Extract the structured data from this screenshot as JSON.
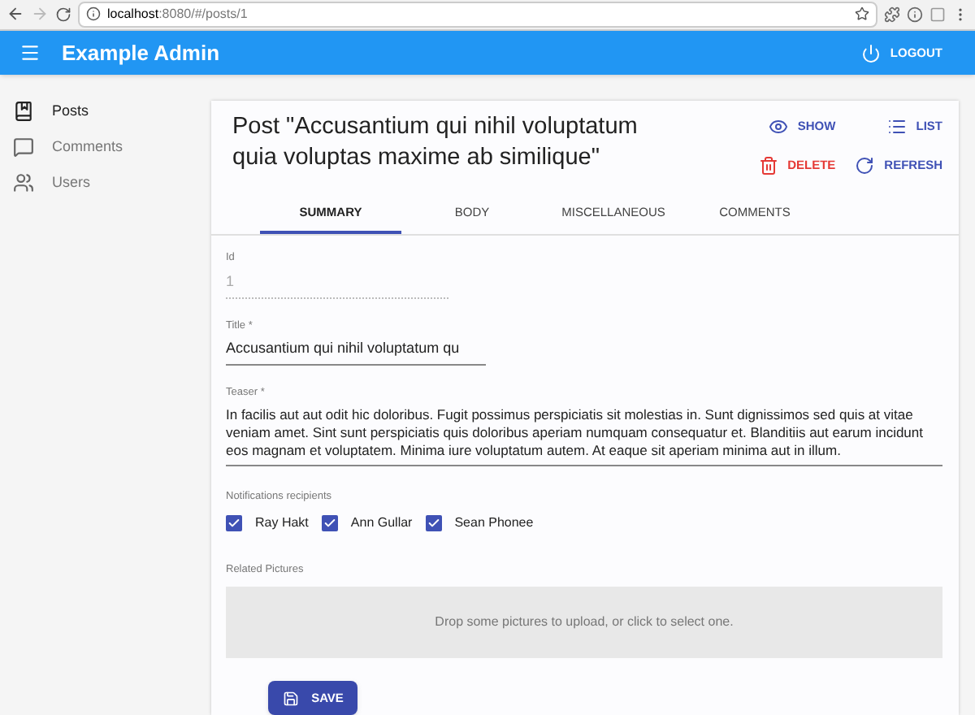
{
  "browser": {
    "url_host": "localhost",
    "url_rest": ":8080/#/posts/1"
  },
  "app_bar": {
    "title": "Example Admin",
    "logout": "LOGOUT"
  },
  "sidebar": {
    "items": [
      {
        "kind": "book",
        "label": "Posts",
        "selected": true
      },
      {
        "kind": "comment",
        "label": "Comments",
        "selected": false
      },
      {
        "kind": "people",
        "label": "Users",
        "selected": false
      }
    ]
  },
  "page": {
    "title": "Post \"Accusantium qui nihil voluptatum quia voluptas maxime ab similique\"",
    "actions": [
      {
        "kind": "show",
        "label": "SHOW"
      },
      {
        "kind": "list",
        "label": "LIST"
      },
      {
        "kind": "delete",
        "label": "DELETE"
      },
      {
        "kind": "refresh",
        "label": "REFRESH"
      }
    ],
    "tabs": [
      {
        "label": "SUMMARY",
        "selected": true
      },
      {
        "label": "BODY",
        "selected": false
      },
      {
        "label": "MISCELLANEOUS",
        "selected": false
      },
      {
        "label": "COMMENTS",
        "selected": false
      }
    ],
    "fields": {
      "id": {
        "label": "Id",
        "value": "1",
        "disabled": true
      },
      "title": {
        "label": "Title *",
        "value": "Accusantium qui nihil voluptatum qu"
      },
      "teaser": {
        "label": "Teaser *",
        "value": "In facilis aut aut odit hic doloribus. Fugit possimus perspiciatis sit molestias in. Sunt dignissimos sed quis at vitae veniam amet. Sint sunt perspiciatis quis doloribus aperiam numquam consequatur et. Blanditiis aut earum incidunt eos magnam et voluptatem. Minima iure voluptatum autem. At eaque sit aperiam minima aut in illum."
      }
    },
    "recipients": {
      "label": "Notifications recipients",
      "options": [
        {
          "label": "Ray Hakt",
          "checked": true
        },
        {
          "label": "Ann Gullar",
          "checked": true
        },
        {
          "label": "Sean Phonee",
          "checked": true
        }
      ]
    },
    "pictures": {
      "label": "Related Pictures",
      "dropzone": "Drop some pictures to upload, or click to select one."
    },
    "save": "SAVE"
  }
}
